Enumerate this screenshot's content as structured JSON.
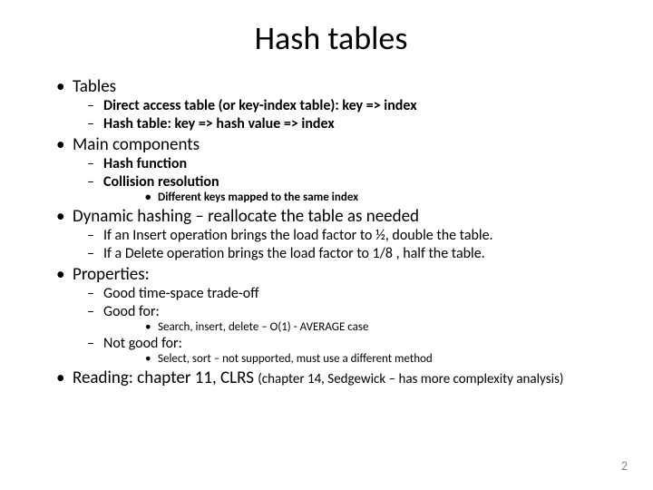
{
  "title": "Hash tables",
  "b1": "Tables",
  "b1_1": "Direct access table (or key-index table):  key => index",
  "b1_2": "Hash table:   key => hash value => index",
  "b2": "Main components",
  "b2_1": "Hash function",
  "b2_2": "Collision resolution",
  "b2_2_1": "Different keys mapped to the same index",
  "b3": "Dynamic hashing – reallocate the table as needed",
  "b3_1": "If an Insert operation brings the load factor to ½, double the table.",
  "b3_2": "If a Delete operation brings the load factor to 1/8 , half the table.",
  "b4": "Properties:",
  "b4_1": "Good time-space trade-off",
  "b4_2": "Good for:",
  "b4_2_1": "Search, insert, delete – O(1) - AVERAGE case",
  "b4_3": "Not good for:",
  "b4_3_1": "Select, sort – not supported, must use a different method",
  "b5": "Reading: chapter 11, CLRS",
  "b5_note": "(chapter 14, Sedgewick – has more complexity analysis)",
  "slide_number": "2"
}
